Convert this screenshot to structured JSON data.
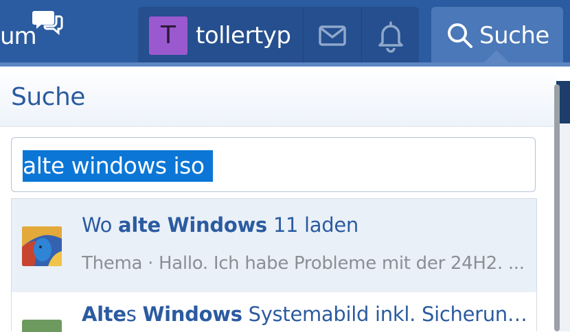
{
  "nav": {
    "forum_fragment": "um",
    "username": "tollertyp",
    "avatar_letter": "T",
    "search_label": "Suche"
  },
  "panel": {
    "title": "Suche",
    "query": "alte windows iso"
  },
  "results": [
    {
      "title_parts": [
        {
          "text": "Wo ",
          "bold": false
        },
        {
          "text": "alte Windows",
          "bold": true
        },
        {
          "text": " 11 laden",
          "bold": false
        }
      ],
      "snippet": "Thema · Hallo. Ich habe Probleme mit der 24H2. ..."
    },
    {
      "title_parts": [
        {
          "text": "Alte",
          "bold": true
        },
        {
          "text": "s ",
          "bold": false
        },
        {
          "text": "Windows",
          "bold": true
        },
        {
          "text": " Systemabild inkl. Sicherung l...",
          "bold": false
        }
      ]
    }
  ],
  "colors": {
    "nav_bg": "#2b5ba0",
    "accent": "#5d86c2",
    "selection": "#0b76d6",
    "link": "#2b5ba0"
  }
}
